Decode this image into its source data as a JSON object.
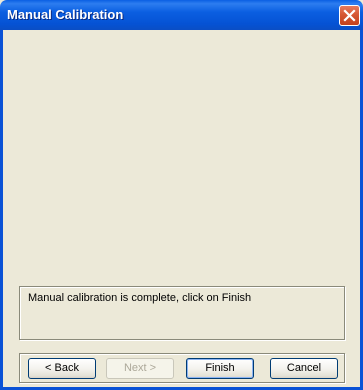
{
  "window": {
    "title": "Manual Calibration",
    "close_icon": "close-icon"
  },
  "status": {
    "message": "Manual calibration is complete, click on Finish"
  },
  "buttons": {
    "back": "< Back",
    "next": "Next >",
    "finish": "Finish",
    "cancel": "Cancel"
  },
  "colors": {
    "titlebar": "#0552d4",
    "dialog_background": "#ece9d8",
    "close_button": "#d65733"
  }
}
